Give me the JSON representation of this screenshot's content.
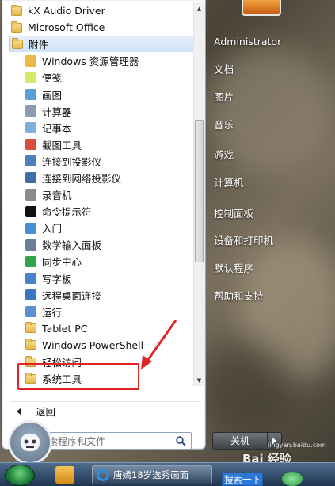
{
  "program_list": [
    {
      "label": "kX Audio Driver",
      "icon": "folder-icon",
      "level": 0
    },
    {
      "label": "Microsoft Office",
      "icon": "folder-icon",
      "level": 0
    },
    {
      "label": "附件",
      "icon": "folder-icon",
      "level": 0,
      "selected": true
    },
    {
      "label": "Windows 资源管理器",
      "icon": "explorer-icon",
      "level": 1
    },
    {
      "label": "便笺",
      "icon": "sticky-notes-icon",
      "level": 1
    },
    {
      "label": "画图",
      "icon": "paint-icon",
      "level": 1
    },
    {
      "label": "计算器",
      "icon": "calculator-icon",
      "level": 1
    },
    {
      "label": "记事本",
      "icon": "notepad-icon",
      "level": 1
    },
    {
      "label": "截图工具",
      "icon": "snipping-tool-icon",
      "level": 1
    },
    {
      "label": "连接到投影仪",
      "icon": "projector-icon",
      "level": 1
    },
    {
      "label": "连接到网络投影仪",
      "icon": "network-projector-icon",
      "level": 1
    },
    {
      "label": "录音机",
      "icon": "microphone-icon",
      "level": 1
    },
    {
      "label": "命令提示符",
      "icon": "command-prompt-icon",
      "level": 1
    },
    {
      "label": "入门",
      "icon": "getting-started-icon",
      "level": 1
    },
    {
      "label": "数学输入面板",
      "icon": "math-input-icon",
      "level": 1
    },
    {
      "label": "同步中心",
      "icon": "sync-center-icon",
      "level": 1
    },
    {
      "label": "写字板",
      "icon": "wordpad-icon",
      "level": 1
    },
    {
      "label": "远程桌面连接",
      "icon": "remote-desktop-icon",
      "level": 1
    },
    {
      "label": "运行",
      "icon": "run-icon",
      "level": 1
    },
    {
      "label": "Tablet PC",
      "icon": "folder-icon",
      "level": 1
    },
    {
      "label": "Windows PowerShell",
      "icon": "folder-icon",
      "level": 1
    },
    {
      "label": "轻松访问",
      "icon": "folder-icon",
      "level": 1
    },
    {
      "label": "系统工具",
      "icon": "folder-icon",
      "level": 1
    }
  ],
  "back_label": "返回",
  "search": {
    "placeholder": "搜索程序和文件"
  },
  "right_pane": {
    "user": "Administrator",
    "items": [
      "文档",
      "图片",
      "音乐",
      "游戏",
      "计算机",
      "控制面板",
      "设备和打印机",
      "默认程序",
      "帮助和支持"
    ]
  },
  "shutdown_label": "关机",
  "taskbar": {
    "task_label": "唐嫣18岁选秀画面",
    "search_button": "搜索一下"
  },
  "watermark": {
    "text": "Bai 经验",
    "url": "jingyan.baidu.com"
  },
  "colors": {
    "highlight": "#e02424",
    "selection": "#cfe3f8"
  }
}
